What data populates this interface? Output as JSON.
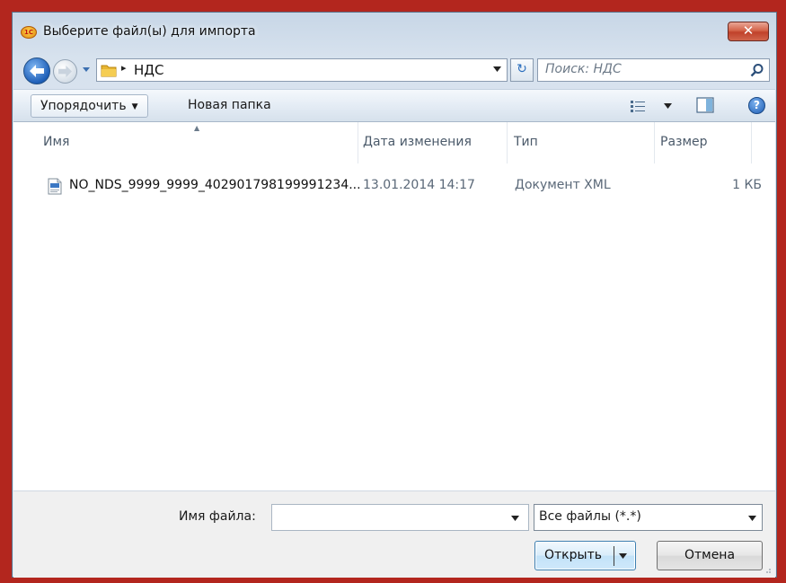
{
  "window": {
    "title": "Выберите файл(ы) для импорта",
    "app_icon_text": "1С",
    "close_symbol": "✕"
  },
  "address": {
    "separator": "▸",
    "path": "НДС",
    "search_placeholder": "Поиск: НДС",
    "refresh_symbol": "↻"
  },
  "toolbar": {
    "organize_label": "Упорядочить",
    "new_folder_label": "Новая папка",
    "help_symbol": "?"
  },
  "columns": {
    "name": "Имя",
    "date": "Дата изменения",
    "type": "Тип",
    "size": "Размер"
  },
  "files": [
    {
      "name": "NO_NDS_9999_9999_40290179819999123­4...",
      "date": "13.01.2014 14:17",
      "type": "Документ XML",
      "size": "1 КБ"
    }
  ],
  "bottom": {
    "filename_label": "Имя файла:",
    "filename_value": "",
    "filter_value": "Все файлы (*.*)",
    "open_label": "Открыть",
    "cancel_label": "Отмена"
  },
  "colors": {
    "frame_red": "#b3261e",
    "window_blue": "#d7e2ee",
    "close_red": "#c0412a"
  }
}
